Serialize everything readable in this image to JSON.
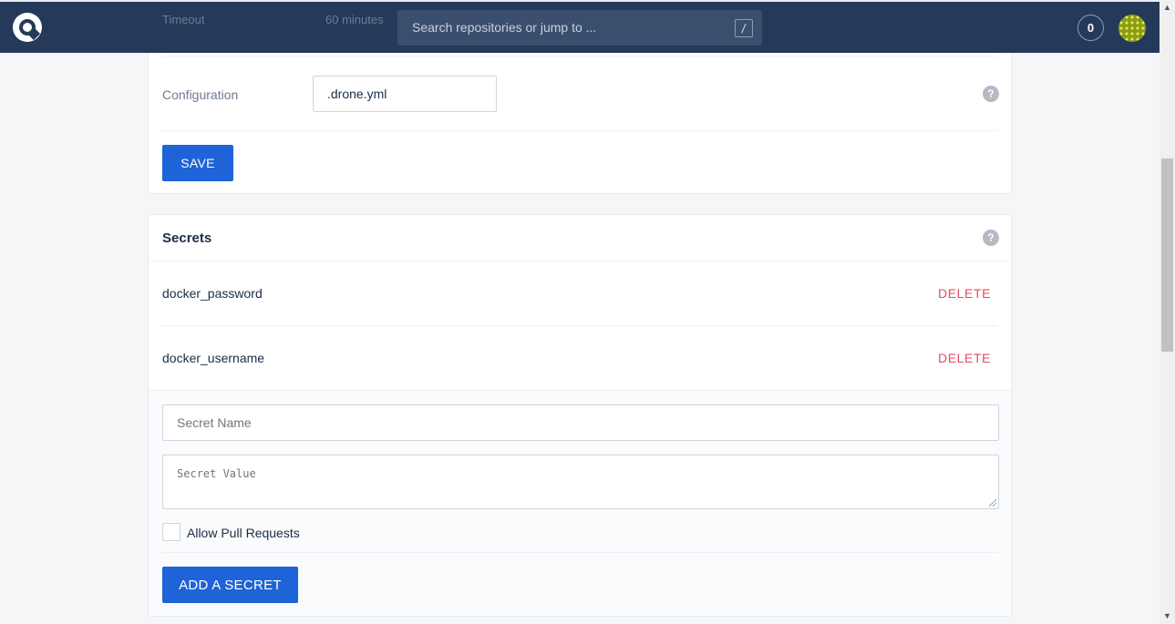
{
  "header": {
    "search_placeholder": "Search repositories or jump to ...",
    "search_shortcut": "/",
    "notification_count": "0"
  },
  "ghost": {
    "timeout_label": "Timeout",
    "timeout_value": "60 minutes"
  },
  "settings": {
    "configuration_label": "Configuration",
    "configuration_value": ".drone.yml",
    "save_label": "SAVE"
  },
  "secrets": {
    "title": "Secrets",
    "items": [
      {
        "name": "docker_password",
        "action": "DELETE"
      },
      {
        "name": "docker_username",
        "action": "DELETE"
      }
    ],
    "form": {
      "name_placeholder": "Secret Name",
      "value_placeholder": "Secret Value",
      "allow_pr_label": "Allow Pull Requests",
      "allow_pr_checked": false,
      "submit_label": "ADD A SECRET"
    }
  },
  "colors": {
    "header_bg": "#253a5b",
    "primary_button": "#1e63d7",
    "delete_red": "#e24c60"
  },
  "icons": {
    "logo": "drone-logo-icon",
    "help": "question-circle-icon",
    "avatar": "user-avatar"
  }
}
